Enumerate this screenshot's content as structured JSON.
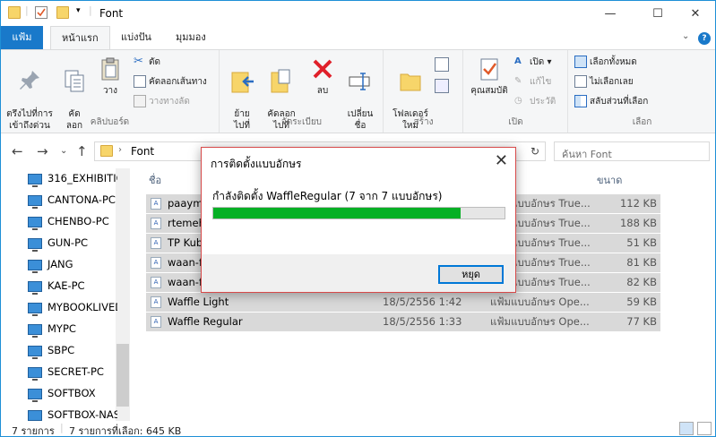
{
  "window": {
    "title": "Font"
  },
  "ribbon_tabs": {
    "file": "แฟ้ม",
    "home": "หน้าแรก",
    "share": "แบ่งปัน",
    "view": "มุมมอง"
  },
  "ribbon": {
    "clipboard": {
      "label": "คลิปบอร์ด",
      "pin": "ตรึงไปที่การ\nเข้าถึงด่วน",
      "copy": "คัด\nลอก",
      "paste": "วาง",
      "cut": "ตัด",
      "copy_path": "คัดลอกเส้นทาง",
      "paste_shortcut": "วางทางลัด"
    },
    "organize": {
      "label": "จัดระเบียบ",
      "move_to": "ย้าย\nไปที่",
      "copy_to": "คัดลอก\nไปที่",
      "delete": "ลบ",
      "rename": "เปลี่ยน\nชื่อ"
    },
    "new": {
      "label": "สร้าง",
      "new_folder": "โฟลเดอร์\nใหม่"
    },
    "open": {
      "label": "เปิด",
      "properties": "คุณสมบัติ",
      "open": "เปิด",
      "edit": "แก้ไข",
      "history": "ประวัติ"
    },
    "select": {
      "label": "เลือก",
      "select_all": "เลือกทั้งหมด",
      "select_none": "ไม่เลือกเลย",
      "invert": "สลับส่วนที่เลือก"
    }
  },
  "address": {
    "path": "Font",
    "search_placeholder": "ค้นหา Font"
  },
  "nav_items": [
    "316_EXHIBITIO",
    "CANTONA-PC",
    "CHENBO-PC",
    "GUN-PC",
    "JANG",
    "KAE-PC",
    "MYBOOKLIVED",
    "MYPC",
    "SBPC",
    "SECRET-PC",
    "SOFTBOX",
    "SOFTBOX-NAS"
  ],
  "columns": {
    "name": "ชื่อ",
    "size": "ขนาด"
  },
  "files": [
    {
      "name": "paaym",
      "date": "",
      "type": "แฟ้มแบบอักษร True...",
      "size": "112 KB"
    },
    {
      "name": "rtemeh",
      "date": "",
      "type": "แฟ้มแบบอักษร True...",
      "size": "188 KB"
    },
    {
      "name": "TP Kub",
      "date": "",
      "type": "แฟ้มแบบอักษร True...",
      "size": "51 KB"
    },
    {
      "name": "waan-f",
      "date": "",
      "type": "แฟ้มแบบอักษร True...",
      "size": "81 KB"
    },
    {
      "name": "waan-f",
      "date": "",
      "type": "แฟ้มแบบอักษร True...",
      "size": "82 KB"
    },
    {
      "name": "Waffle Light",
      "date": "18/5/2556 1:42",
      "type": "แฟ้มแบบอักษร Ope...",
      "size": "59 KB"
    },
    {
      "name": "Waffle Regular",
      "date": "18/5/2556 1:33",
      "type": "แฟ้มแบบอักษร Ope...",
      "size": "77 KB"
    }
  ],
  "status": {
    "items": "7 รายการ",
    "selected": "7 รายการที่เลือก: 645 KB"
  },
  "dialog": {
    "title": "การติดตั้งแบบอักษร",
    "message": "กำลังติดตั้ง WaffleRegular (7 จาก 7 แบบอักษร)",
    "progress": 0.85,
    "stop": "หยุด"
  },
  "colors": {
    "accent": "#1979ca",
    "progress": "#06b025",
    "selection": "#d9d9d9"
  }
}
